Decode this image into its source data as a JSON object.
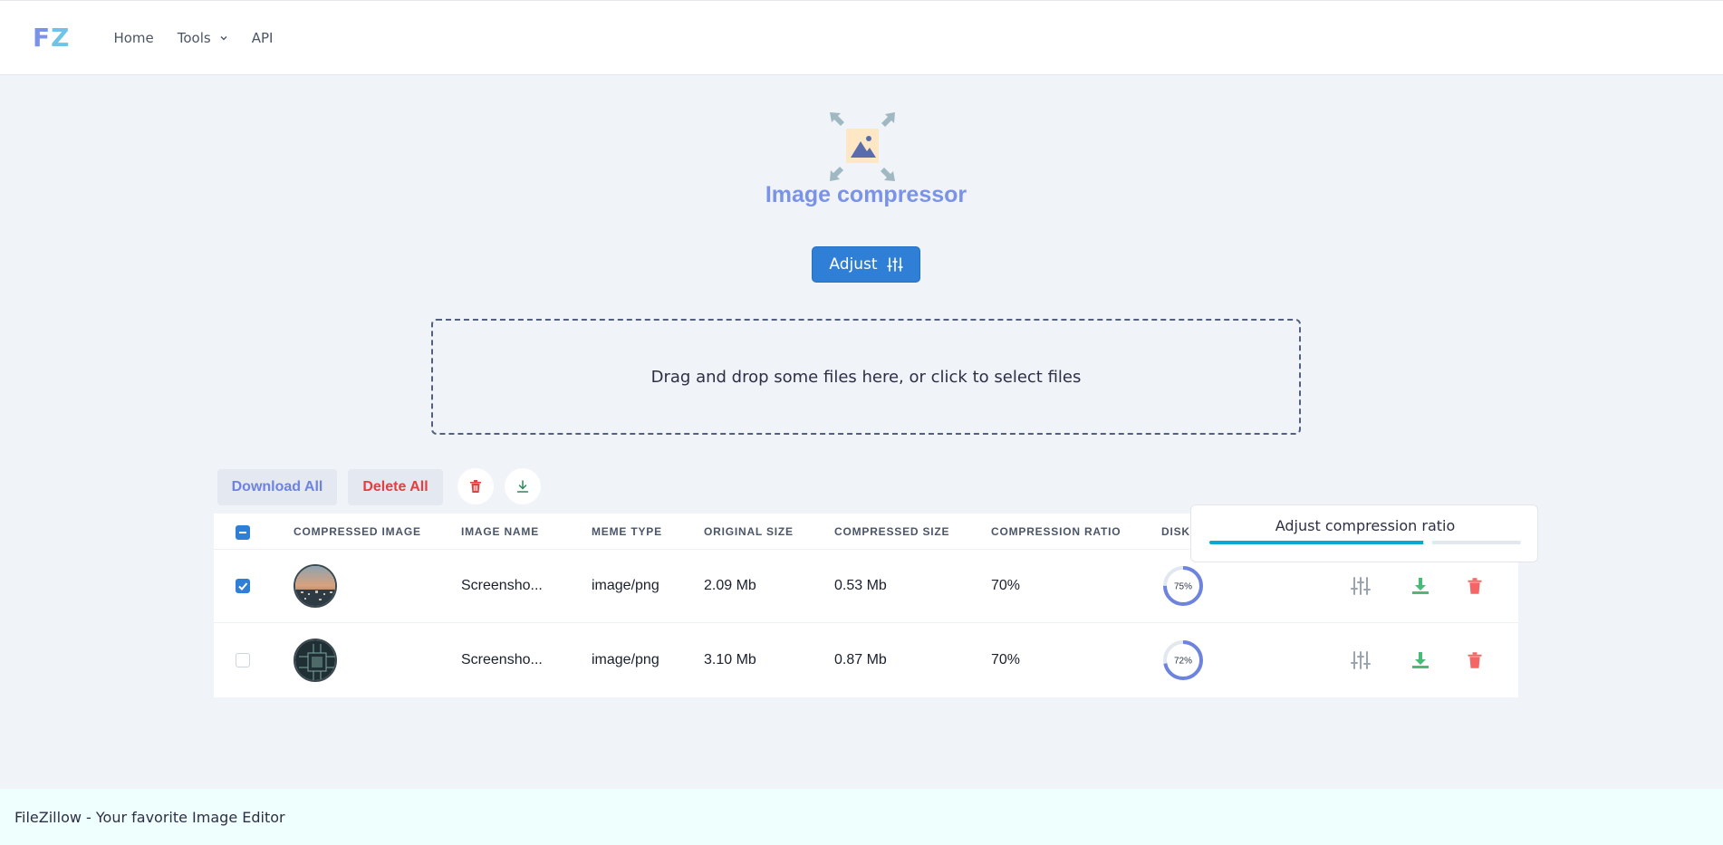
{
  "header": {
    "logo_f": "F",
    "logo_z": "Z",
    "nav": [
      {
        "label": "Home"
      },
      {
        "label": "Tools"
      },
      {
        "label": "API"
      }
    ]
  },
  "hero": {
    "title": "Image compressor",
    "adjust_label": "Adjust"
  },
  "dropzone": {
    "text": "Drag and drop some files here, or click to select files"
  },
  "actions": {
    "download_all": "Download All",
    "delete_all": "Delete All"
  },
  "table": {
    "columns": [
      "COMPRESSED IMAGE",
      "IMAGE NAME",
      "MEME TYPE",
      "ORIGINAL SIZE",
      "COMPRESSED SIZE",
      "COMPRESSION RATIO",
      "DISK"
    ],
    "rows": [
      {
        "checked": true,
        "name": "Screensho...",
        "type": "image/png",
        "original": "2.09 Mb",
        "compressed": "0.53 Mb",
        "ratio": "70%",
        "disk": "75%",
        "disk_value": 75,
        "thumb": "city-thumbnail"
      },
      {
        "checked": false,
        "name": "Screensho...",
        "type": "image/png",
        "original": "3.10 Mb",
        "compressed": "0.87 Mb",
        "ratio": "70%",
        "disk": "72%",
        "disk_value": 72,
        "thumb": "circuit-thumbnail"
      }
    ]
  },
  "popover": {
    "title": "Adjust compression ratio",
    "value": 0.7
  },
  "footer": {
    "text": "FileZillow - Your favorite Image Editor"
  },
  "colors": {
    "accent": "#2f7fd6",
    "title": "#7a93e8",
    "danger": "#e53e3e",
    "success": "#48bb78",
    "slider": "#0ba9d2"
  }
}
